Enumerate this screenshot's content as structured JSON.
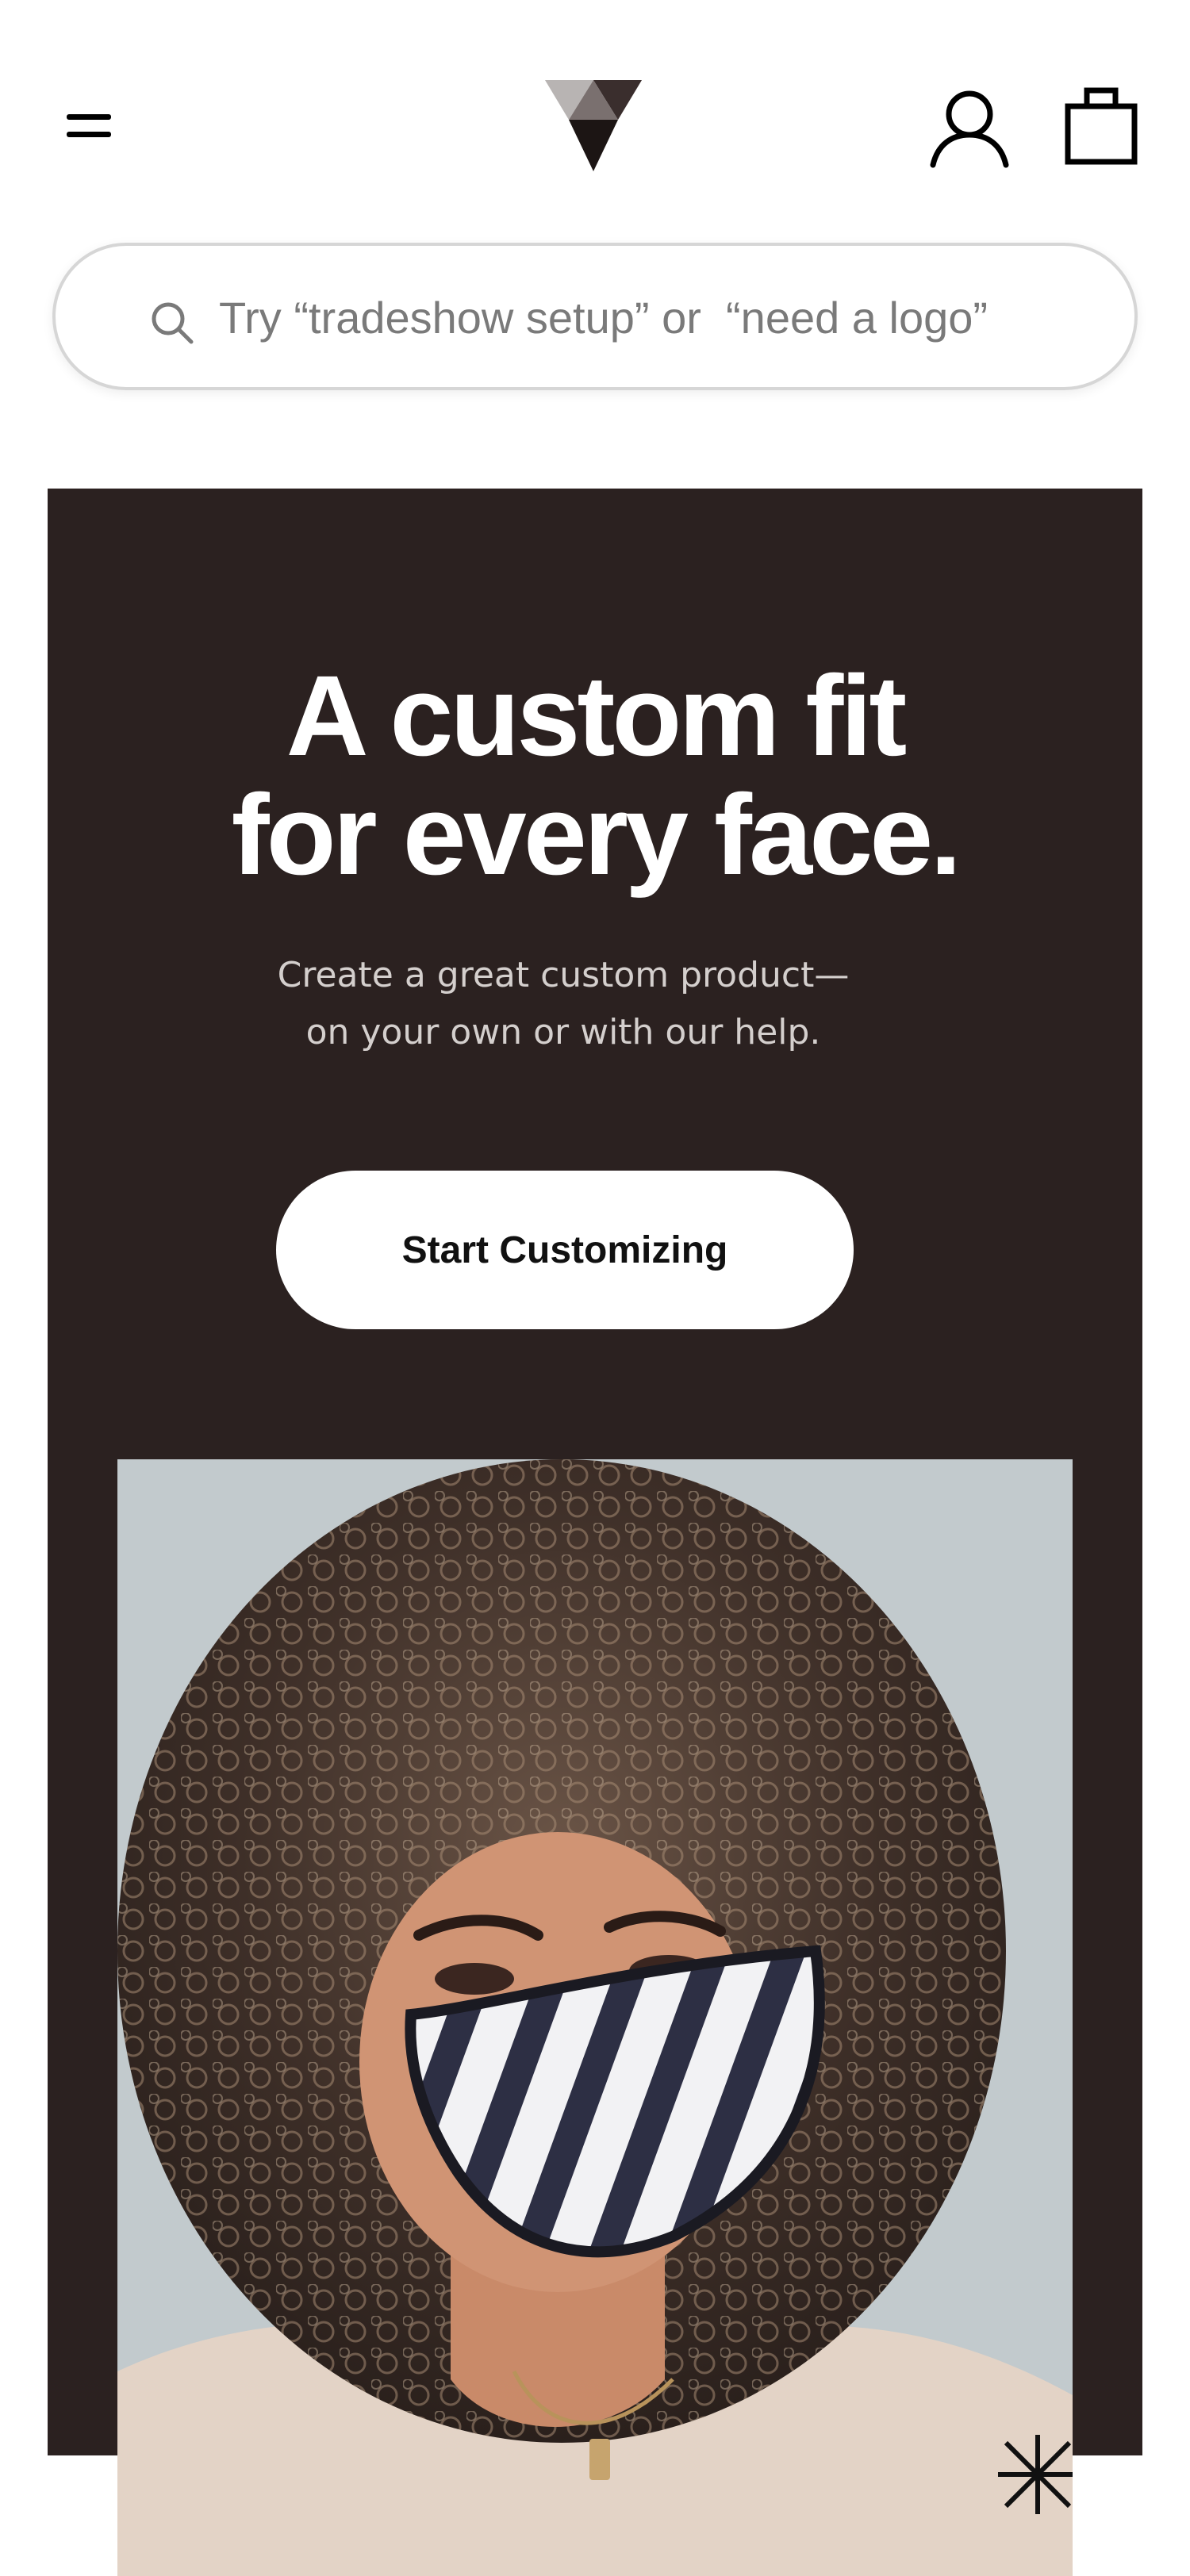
{
  "header": {
    "menu_icon": "menu-icon",
    "logo_icon": "brand-logo-icon",
    "account_icon": "user-icon",
    "cart_icon": "shopping-bag-icon"
  },
  "search": {
    "placeholder": "Try “tradeshow setup” or  “need a logo”",
    "icon": "search-icon"
  },
  "hero": {
    "title_line1": "A custom fit",
    "title_line2": "for every face.",
    "subtitle_line1": "Create a great custom product—",
    "subtitle_line2": "on your own or with our help.",
    "cta_label": "Start Customizing",
    "image_icon": "hero-photo-masked-woman"
  },
  "colors": {
    "hero_background": "#2b2120",
    "cta_background": "#ffffff",
    "title_text": "#ffffff",
    "subtitle_text": "#d4cfcd"
  }
}
